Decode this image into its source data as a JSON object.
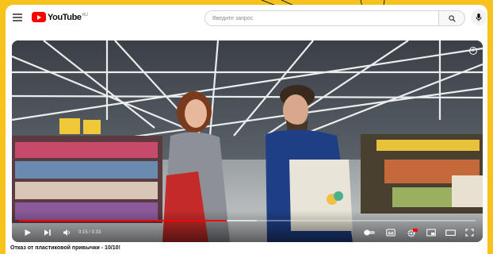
{
  "app": {
    "name": "YouTube",
    "region_code": "RU"
  },
  "header": {
    "search_placeholder": "Введите запрос",
    "icons": [
      "menu-icon",
      "youtube-logo",
      "search-icon",
      "mic-icon"
    ]
  },
  "player": {
    "current_time": "0:15",
    "duration": "0:33",
    "time_display": "0:15 / 0:33",
    "progress_fraction": 0.455,
    "buffered_fraction": 0.52,
    "icons": [
      "play-icon",
      "next-icon",
      "volume-icon",
      "autoplay-toggle-icon",
      "subtitles-icon",
      "settings-icon",
      "miniplayer-icon",
      "theater-icon",
      "fullscreen-icon",
      "info-icon"
    ],
    "settings_badge": "HD"
  },
  "video": {
    "title": "Отказ от пластиковой привычки - 10/10!"
  },
  "colors": {
    "page_background": "#f7c21c",
    "brand_red": "#ff0000",
    "progress": "#ff0000"
  }
}
